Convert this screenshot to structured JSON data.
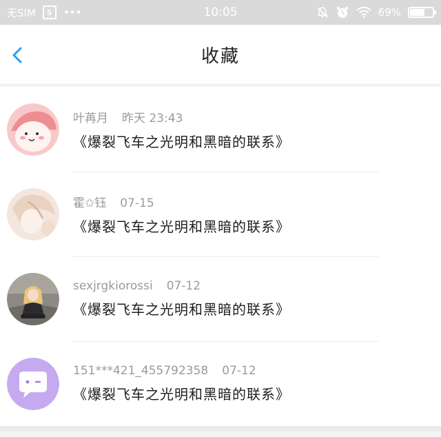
{
  "status_bar": {
    "carrier": "无SIM",
    "dots": "•••",
    "time": "10:05",
    "battery": "69%",
    "battery_level": 0.69
  },
  "header": {
    "title": "收藏"
  },
  "favorites": [
    {
      "author": "叶苒月",
      "time": "昨天 23:43",
      "text": "《爆裂飞车之光明和黑暗的联系》"
    },
    {
      "author": "霍✩钰",
      "time": "07-15",
      "text": "《爆裂飞车之光明和黑暗的联系》"
    },
    {
      "author": "sexjrgkiorossi",
      "time": "07-12",
      "text": "《爆裂飞车之光明和黑暗的联系》"
    },
    {
      "author": "151***421_455792358",
      "time": "07-12",
      "text": "《爆裂飞车之光明和黑暗的联系》"
    }
  ],
  "colors": {
    "accent": "#2a9df4",
    "status_bar": "#dadada",
    "background": "#f4f4f6"
  }
}
